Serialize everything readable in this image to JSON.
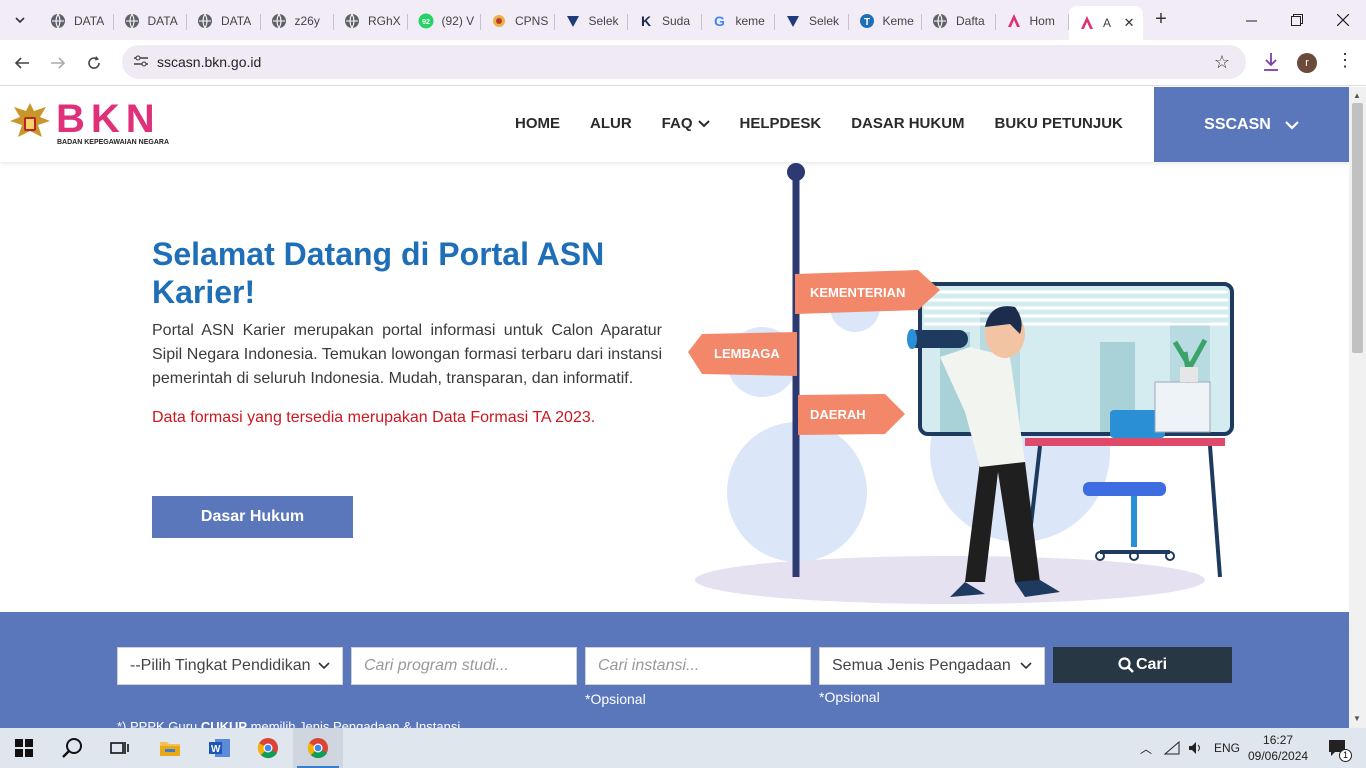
{
  "browser": {
    "tabs": [
      {
        "title": "DATA",
        "icon": "globe-icon"
      },
      {
        "title": "DATA",
        "icon": "globe-icon"
      },
      {
        "title": "DATA",
        "icon": "globe-icon"
      },
      {
        "title": "z26y",
        "icon": "globe-icon"
      },
      {
        "title": "RGhX",
        "icon": "globe-icon"
      },
      {
        "title": "(92) V",
        "icon": "whatsapp-icon",
        "badge": "92"
      },
      {
        "title": "CPNS",
        "icon": "cpns-icon"
      },
      {
        "title": "Selek",
        "icon": "sscasn-icon"
      },
      {
        "title": "Suda",
        "icon": "k-icon"
      },
      {
        "title": "keme",
        "icon": "google-icon"
      },
      {
        "title": "Selek",
        "icon": "sscasn-icon"
      },
      {
        "title": "Keme",
        "icon": "t-icon"
      },
      {
        "title": "Dafta",
        "icon": "globe-icon"
      },
      {
        "title": "Hom",
        "icon": "asn-icon"
      },
      {
        "title": "A",
        "icon": "asn-icon",
        "active": true
      }
    ],
    "url": "sscasn.bkn.go.id",
    "profile_initial": "r"
  },
  "header": {
    "logo_text": "BKN",
    "logo_subtitle": "BADAN KEPEGAWAIAN NEGARA",
    "menu": [
      "HOME",
      "ALUR",
      "FAQ",
      "HELPDESK",
      "DASAR HUKUM",
      "BUKU PETUNJUK"
    ],
    "sscasn_label": "SSCASN"
  },
  "hero": {
    "title": "Selamat Datang di Portal ASN Karier!",
    "description": "Portal ASN Karier merupakan portal informasi untuk Calon Aparatur Sipil Negara Indonesia. Temukan lowongan formasi terbaru dari instansi pemerintah di seluruh Indonesia. Mudah, transparan, dan informatif.",
    "note": "Data formasi yang tersedia merupakan Data Formasi TA 2023.",
    "button": "Dasar Hukum",
    "signs": [
      "KEMENTERIAN",
      "LEMBAGA",
      "DAERAH"
    ]
  },
  "search": {
    "education_select": "--Pilih Tingkat Pendidikan",
    "program_placeholder": "Cari program studi...",
    "instansi_placeholder": "Cari instansi...",
    "procurement_select": "Semua Jenis Pengadaan",
    "optional_label": "*Opsional",
    "search_button": "Cari",
    "footnote_prefix": "*) PPPK Guru ",
    "footnote_bold": "CUKUP",
    "footnote_suffix": " memilih Jenis Pengadaan & Instansi"
  },
  "taskbar": {
    "language": "ENG",
    "time": "16:27",
    "date": "09/06/2024",
    "notification_count": "1"
  },
  "colors": {
    "primary_blue": "#5b77bc",
    "title_blue": "#1f6eb8",
    "note_red": "#d0161e",
    "brand_pink": "#e0307a",
    "dark_button": "#283744"
  }
}
